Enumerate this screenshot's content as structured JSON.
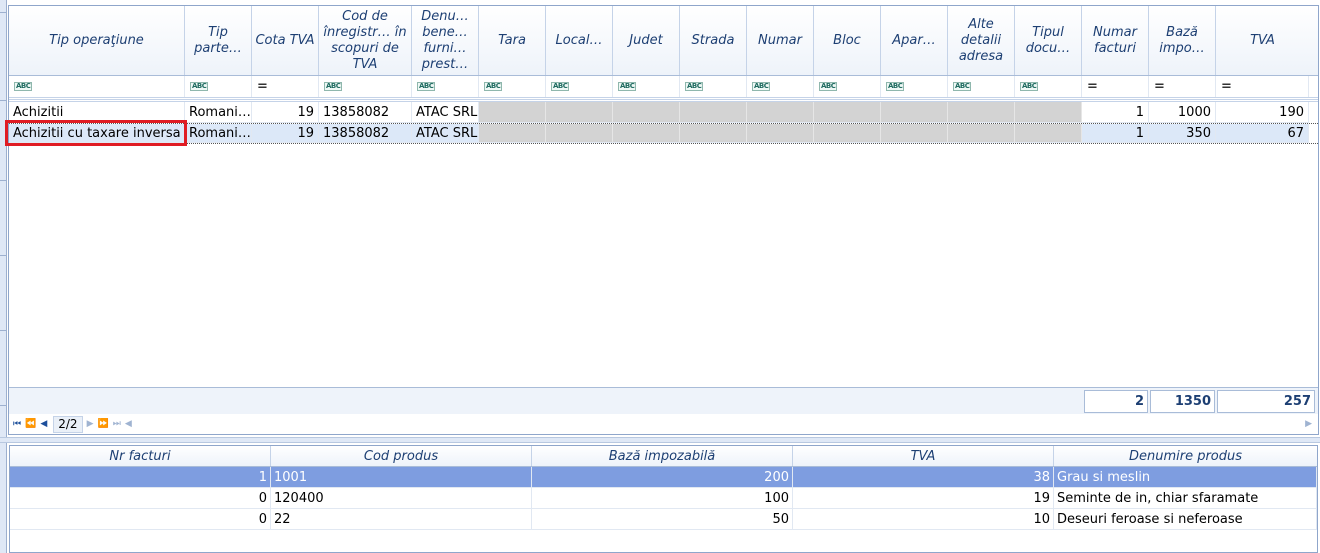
{
  "main_grid": {
    "columns": [
      {
        "key": "tip_operatiune",
        "label": "Tip operaţiune"
      },
      {
        "key": "tip_partener",
        "label": "Tip parte…"
      },
      {
        "key": "cota_tva",
        "label": "Cota TVA"
      },
      {
        "key": "cod_inregistrare",
        "label": "Cod de înregistr… în scopuri de TVA"
      },
      {
        "key": "denumire",
        "label": "Denu… bene… furni… prest…"
      },
      {
        "key": "tara",
        "label": "Tara"
      },
      {
        "key": "localitate",
        "label": "Local…"
      },
      {
        "key": "judet",
        "label": "Judet"
      },
      {
        "key": "strada",
        "label": "Strada"
      },
      {
        "key": "numar",
        "label": "Numar"
      },
      {
        "key": "bloc",
        "label": "Bloc"
      },
      {
        "key": "apartament",
        "label": "Apar…"
      },
      {
        "key": "alte_detalii",
        "label": "Alte detalii adresa"
      },
      {
        "key": "tipul_document",
        "label": "Tipul docu…"
      },
      {
        "key": "numar_facturi",
        "label": "Numar facturi"
      },
      {
        "key": "baza_impozabila",
        "label": "Bază impo…"
      },
      {
        "key": "tva",
        "label": "TVA"
      }
    ],
    "filters": [
      "abc",
      "abc",
      "=",
      "abc",
      "abc",
      "abc",
      "abc",
      "abc",
      "abc",
      "abc",
      "abc",
      "abc",
      "abc",
      "abc",
      "=",
      "=",
      "="
    ],
    "rows": [
      {
        "tip_operatiune": "Achizitii",
        "tip_partener": "Romani…",
        "cota_tva": "19",
        "cod_inregistrare": "13858082",
        "denumire": "ATAC SRL",
        "numar_facturi": "1",
        "baza_impozabila": "1000",
        "tva": "190"
      },
      {
        "tip_operatiune": "Achizitii cu taxare inversa",
        "tip_partener": "Romani…",
        "cota_tva": "19",
        "cod_inregistrare": "13858082",
        "denumire": "ATAC SRL",
        "numar_facturi": "1",
        "baza_impozabila": "350",
        "tva": "67"
      }
    ],
    "totals": {
      "numar_facturi": "2",
      "baza_impozabila": "1350",
      "tva": "257"
    },
    "pager": {
      "page_label": "2/2"
    }
  },
  "detail_grid": {
    "columns": [
      "Nr facturi",
      "Cod produs",
      "Bază impozabilă",
      "TVA",
      "Denumire produs"
    ],
    "rows": [
      {
        "nr_facturi": "1",
        "cod_produs": "1001",
        "baza": "200",
        "tva": "38",
        "denumire": "Grau si meslin"
      },
      {
        "nr_facturi": "0",
        "cod_produs": "120400",
        "baza": "100",
        "tva": "19",
        "denumire": "Seminte de in, chiar sfaramate"
      },
      {
        "nr_facturi": "0",
        "cod_produs": "22",
        "baza": "50",
        "tva": "10",
        "denumire": "Deseuri feroase si neferoase"
      }
    ]
  },
  "colors": {
    "header_text": "#1d3f73",
    "selected_row": "#dce8f8",
    "selected_detail_row": "#7e9de0",
    "highlight_border": "#e01c24",
    "gray_cell": "#d3d3d3"
  }
}
